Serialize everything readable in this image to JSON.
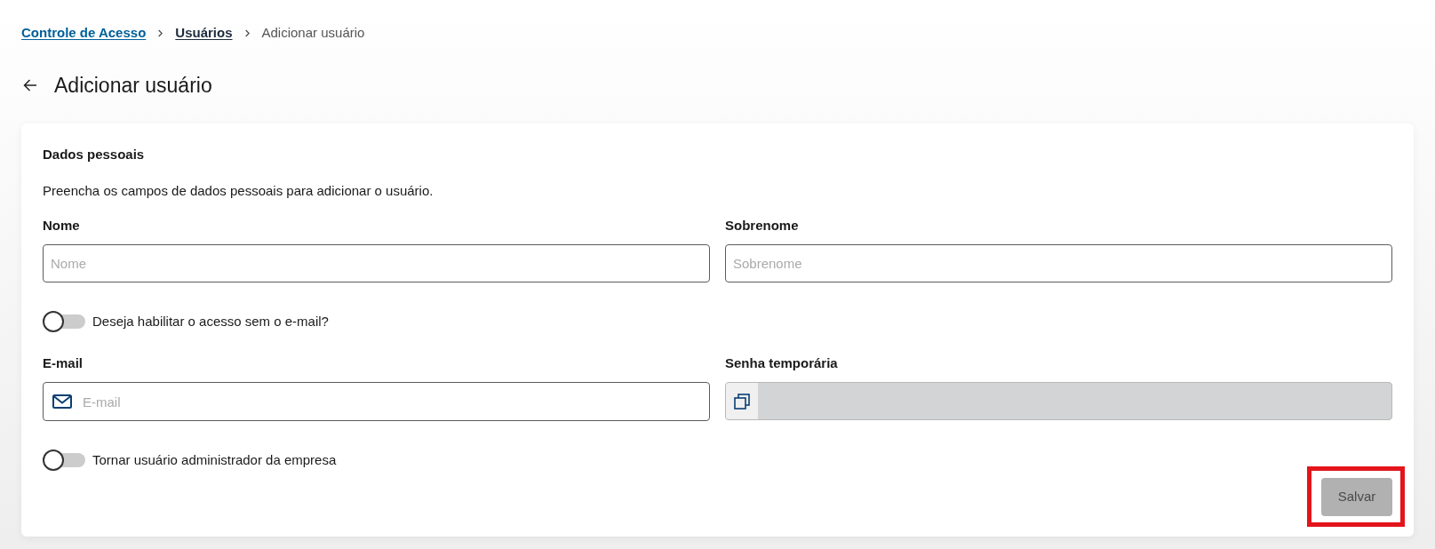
{
  "breadcrumb": [
    {
      "kind": "link",
      "label": "Controle de Acesso"
    },
    {
      "kind": "parent",
      "label": "Usuários"
    },
    {
      "kind": "current",
      "label": "Adicionar usuário"
    }
  ],
  "page_title": "Adicionar usuário",
  "section": {
    "title": "Dados pessoais",
    "description": "Preencha os campos de dados pessoais para adicionar o usuário."
  },
  "form": [
    {
      "kind": "fields",
      "fields": [
        {
          "kind": "text",
          "label": "Nome",
          "placeholder": "Nome",
          "disabled": false
        },
        {
          "kind": "text",
          "label": "Sobrenome",
          "placeholder": "Sobrenome",
          "disabled": false
        }
      ]
    },
    {
      "kind": "toggle",
      "label": "Deseja habilitar o acesso sem o e-mail?",
      "on": false
    },
    {
      "kind": "fields",
      "fields": [
        {
          "kind": "email",
          "label": "E-mail",
          "placeholder": "E-mail",
          "disabled": false
        },
        {
          "kind": "copy",
          "label": "Senha temporária",
          "disabled": true
        }
      ]
    },
    {
      "kind": "toggle",
      "label": "Tornar usuário administrador da empresa",
      "on": false
    }
  ],
  "save_button": {
    "label": "Salvar",
    "disabled": true,
    "highlighted": true
  }
}
